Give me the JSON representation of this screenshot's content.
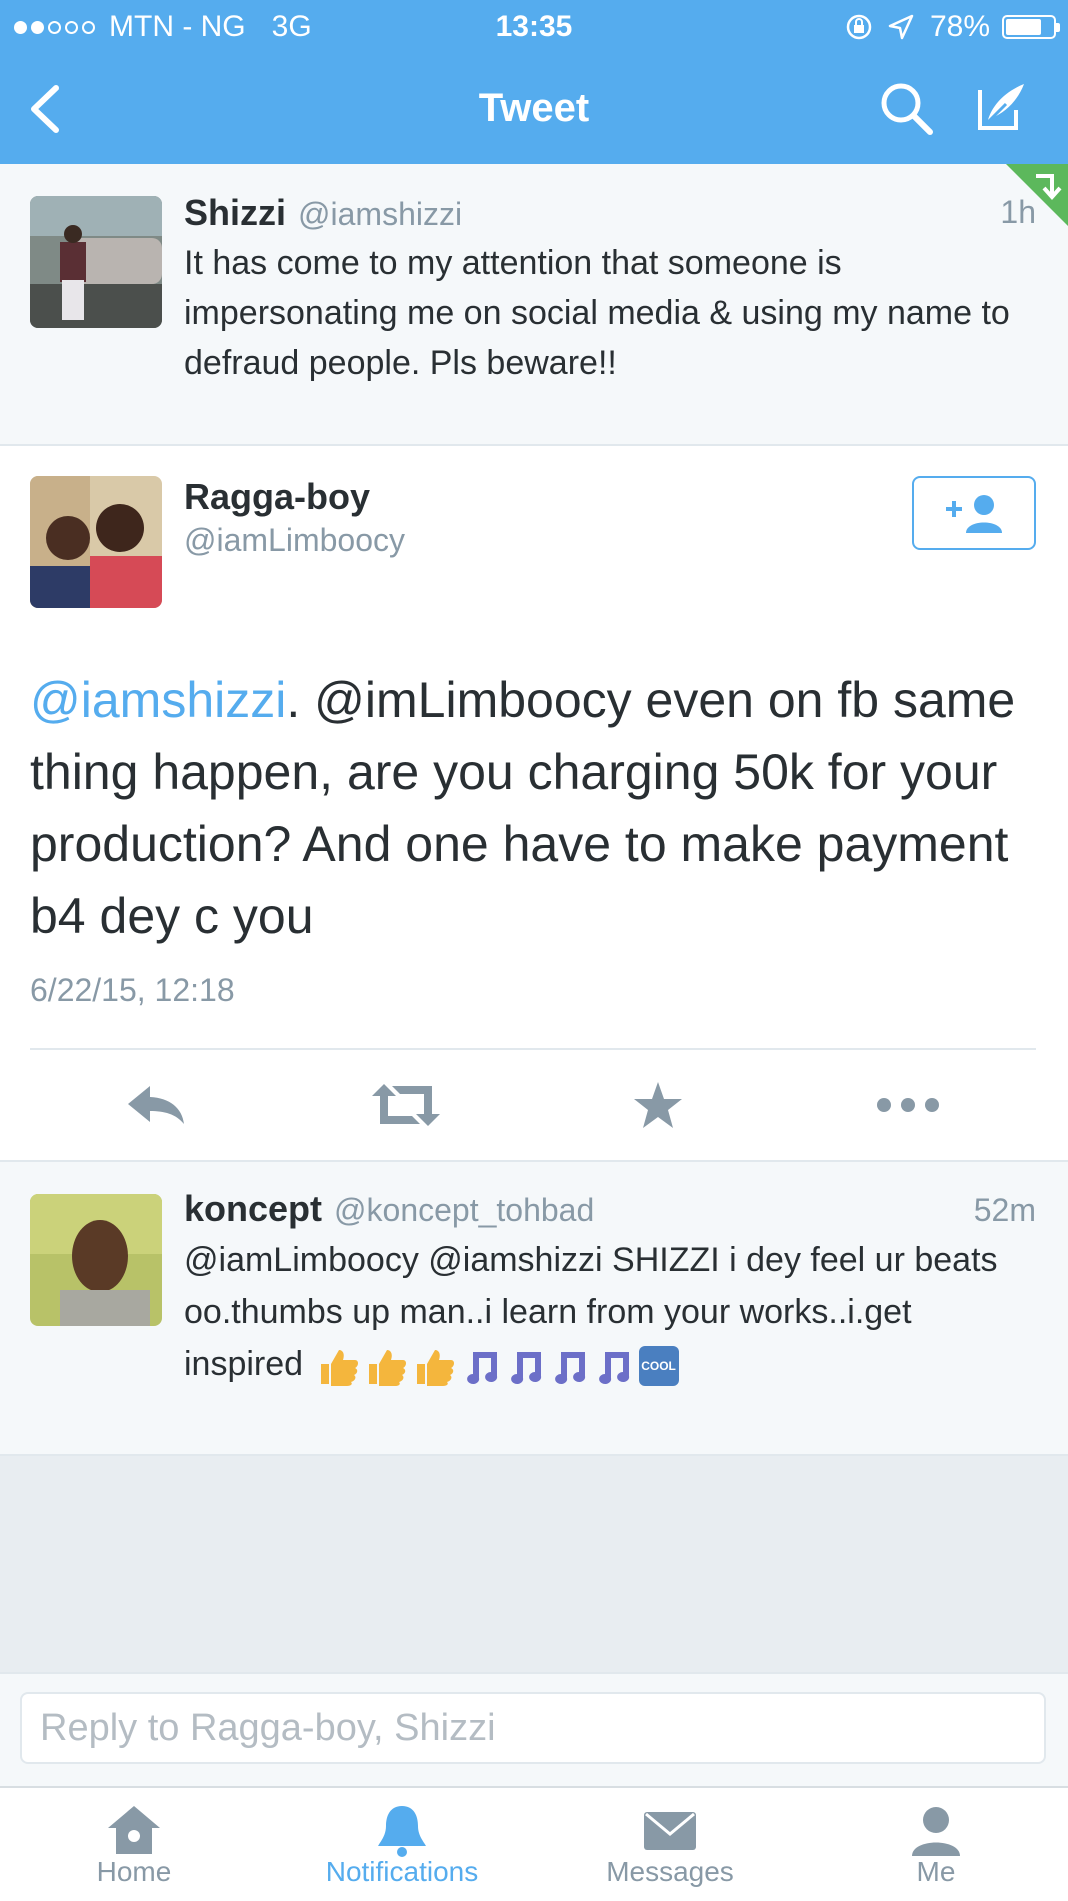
{
  "status_bar": {
    "carrier": "MTN - NG",
    "network": "3G",
    "time": "13:35",
    "battery": "78%"
  },
  "nav": {
    "title": "Tweet",
    "back_icon": "chevron-left-icon",
    "search_icon": "search-icon",
    "compose_icon": "compose-icon"
  },
  "tweets": [
    {
      "name": "Shizzi",
      "handle": "@iamshizzi",
      "time": "1h",
      "text": "It has come to my attention that someone is impersonating me on social media & using my name to defraud people. Pls beware!!"
    },
    {
      "name": "koncept",
      "handle": "@koncept_tohbad",
      "time": "52m",
      "text": "@iamLimboocy @iamshizzi SHIZZI i dey feel ur beats oo.thumbs up man..i learn from your works..i.get inspired",
      "cool_label": "COOL"
    }
  ],
  "detail": {
    "name": "Ragga-boy",
    "handle": "@iamLimboocy",
    "mention": "@iamshizzi",
    "text": ". @imLimboocy even on fb same thing happen, are you charging 50k for your production? And one have to make payment b4 dey c you",
    "date": "6/22/15, 12:18",
    "follow_icon": "add-user-icon"
  },
  "reply": {
    "placeholder": "Reply to Ragga-boy, Shizzi"
  },
  "tabs": [
    {
      "label": "Home",
      "icon": "home-icon"
    },
    {
      "label": "Notifications",
      "icon": "bell-icon"
    },
    {
      "label": "Messages",
      "icon": "envelope-icon"
    },
    {
      "label": "Me",
      "icon": "person-icon"
    }
  ],
  "colors": {
    "accent": "#55acee",
    "text": "#292f33",
    "muted": "#8899a6",
    "corner": "#5cb85c"
  }
}
